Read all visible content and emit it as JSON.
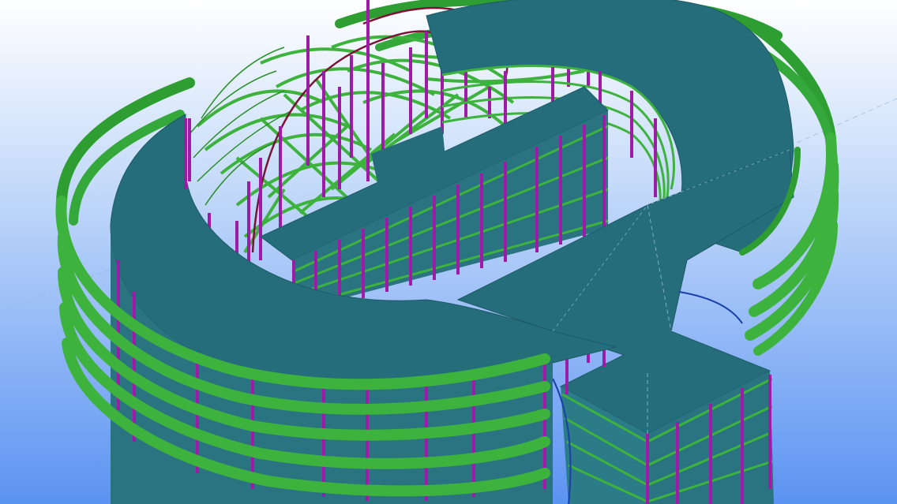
{
  "scene": {
    "kind": "3d-structural-model-view",
    "projection": "isometric",
    "floor_count": 5,
    "colors": {
      "background_top": "#ffffff",
      "background_bottom": "#5b93f2",
      "slab": "#256d7b",
      "slab_edge": "#3a8f6b",
      "column": "#a01aa8",
      "beam": "#3db33d",
      "beam_dark": "#2a8f2a",
      "arch": "#7a1535",
      "brace": "#1a3fa8",
      "gridline": "#8fb3d9"
    }
  }
}
